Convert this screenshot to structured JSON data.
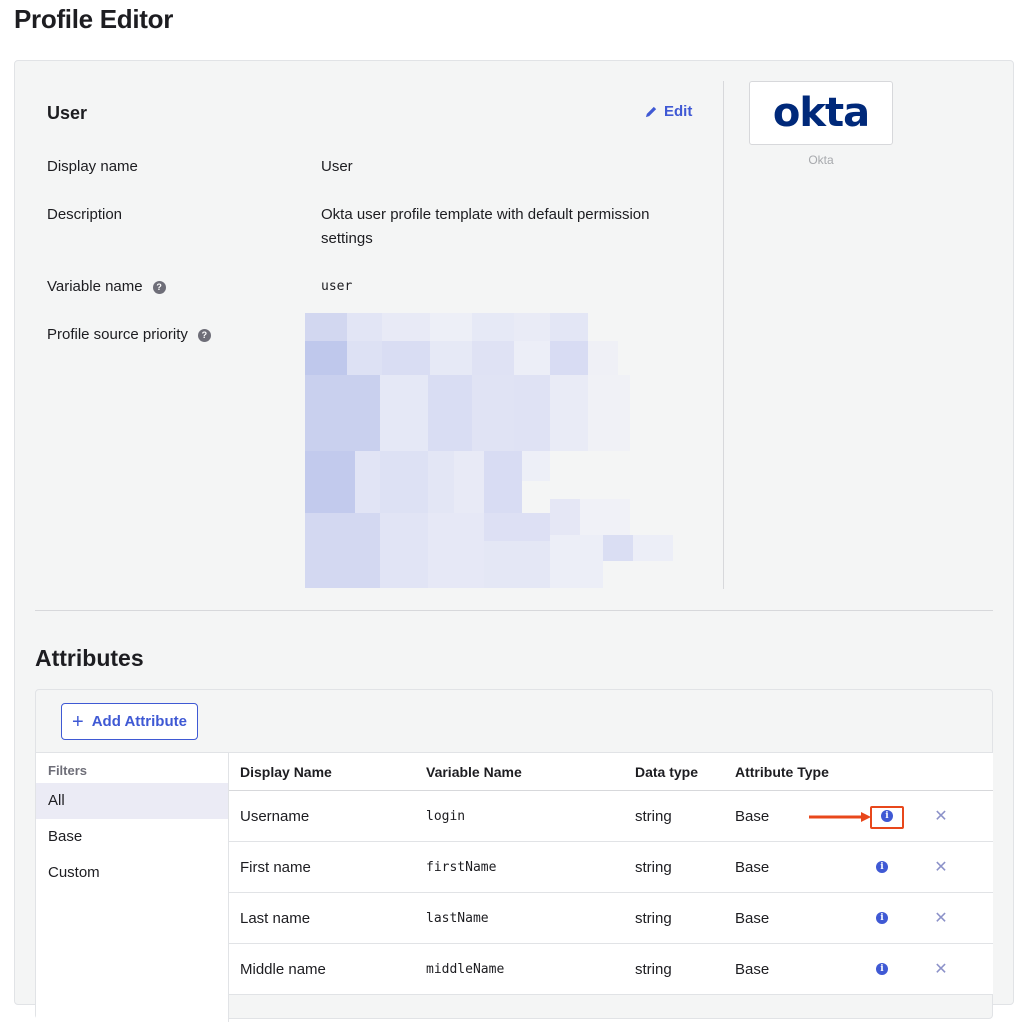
{
  "page_title": "Profile Editor",
  "profile": {
    "section_title": "User",
    "edit_label": "Edit",
    "rows": [
      {
        "label": "Display name",
        "value": "User"
      },
      {
        "label": "Description",
        "value": "Okta user profile template with default permission settings"
      },
      {
        "label": "Variable name",
        "value": "user"
      },
      {
        "label": "Profile source priority",
        "value": ""
      }
    ],
    "app_logo_text": "okta",
    "app_caption": "Okta"
  },
  "attributes": {
    "title": "Attributes",
    "add_button_label": "Add Attribute",
    "filters_label": "Filters",
    "filters": [
      "All",
      "Base",
      "Custom"
    ],
    "active_filter": "All",
    "columns": [
      "Display Name",
      "Variable Name",
      "Data type",
      "Attribute Type"
    ],
    "rows": [
      {
        "display_name": "Username",
        "variable_name": "login",
        "data_type": "string",
        "attribute_type": "Base"
      },
      {
        "display_name": "First name",
        "variable_name": "firstName",
        "data_type": "string",
        "attribute_type": "Base"
      },
      {
        "display_name": "Last name",
        "variable_name": "lastName",
        "data_type": "string",
        "attribute_type": "Base"
      },
      {
        "display_name": "Middle name",
        "variable_name": "middleName",
        "data_type": "string",
        "attribute_type": "Base"
      }
    ]
  },
  "icons": {
    "edit": "pencil-icon",
    "help": "question-icon",
    "info": "info-icon",
    "remove": "close-icon",
    "add": "plus-icon"
  },
  "colors": {
    "accent": "#3f59d4",
    "okta_brand": "#00297a",
    "highlight": "#e8471b"
  }
}
